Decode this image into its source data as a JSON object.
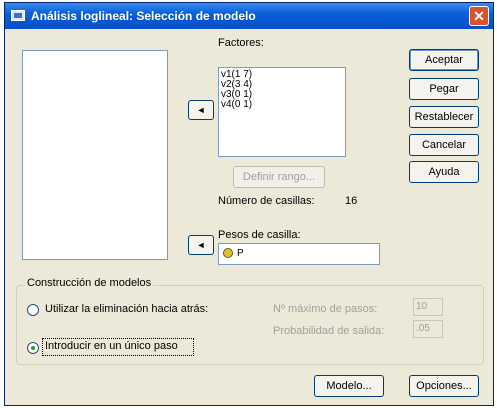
{
  "window": {
    "title": "Análisis loglineal: Selección de modelo"
  },
  "factors": {
    "label": "Factores:",
    "items": [
      "v1(1 7)",
      "v2(3 4)",
      "v3(0 1)",
      "v4(0 1)"
    ],
    "define_range_label": "Definir rango...",
    "cells_label": "Número de casillas:",
    "cells_value": "16"
  },
  "weights": {
    "label": "Pesos de casilla:",
    "value": "P"
  },
  "buttons": {
    "ok": "Aceptar",
    "paste": "Pegar",
    "reset": "Restablecer",
    "cancel": "Cancelar",
    "help": "Ayuda",
    "model": "Modelo...",
    "options": "Opciones..."
  },
  "model_construction": {
    "legend": "Construcción de modelos",
    "backward_label": "Utilizar la eliminación hacia atrás:",
    "backward_selected": false,
    "max_steps_label": "Nº máximo de pasos:",
    "max_steps_value": "10",
    "prob_label": "Probabilidad de salida:",
    "prob_value": ".05",
    "single_step_label": "Introducir en un único paso",
    "single_step_selected": true
  },
  "icons": {
    "arrow_left": "◄",
    "close": "✕"
  }
}
